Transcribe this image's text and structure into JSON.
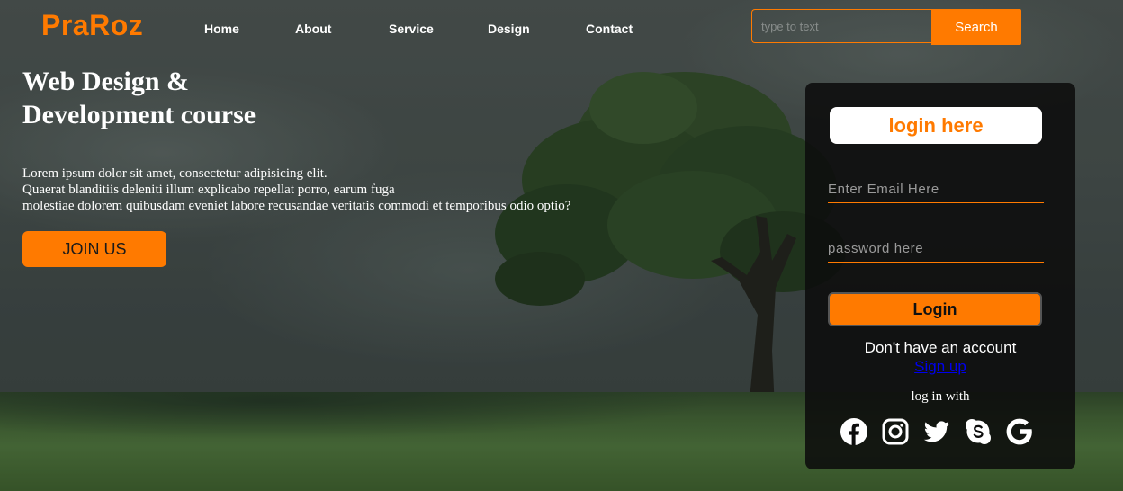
{
  "header": {
    "logo": "PraRoz",
    "nav": [
      "Home",
      "About",
      "Service",
      "Design",
      "Contact"
    ],
    "search": {
      "placeholder": "type to text",
      "button_label": "Search"
    }
  },
  "hero": {
    "title": "Web Design & Development course",
    "paragraph_lines": [
      "Lorem ipsum dolor sit amet, consectetur adipisicing elit.",
      "Quaerat blanditiis deleniti illum explicabo repellat porro, earum fuga",
      "molestiae dolorem quibusdam eveniet labore recusandae veritatis commodi et temporibus odio optio?"
    ],
    "cta_label": "JOIN US"
  },
  "login": {
    "title": "login here",
    "email_placeholder": "Enter Email Here",
    "password_placeholder": "password here",
    "button_label": "Login",
    "no_account_text": "Don't have an account",
    "signup_label": "Sign up",
    "login_with_text": "log in with",
    "social_icons": [
      "facebook-icon",
      "instagram-icon",
      "twitter-icon",
      "skype-icon",
      "google-icon"
    ]
  },
  "colors": {
    "accent": "#ff7a00",
    "card_background": "#0c0c0c",
    "text": "#ffffff",
    "link": "#0000ee"
  }
}
